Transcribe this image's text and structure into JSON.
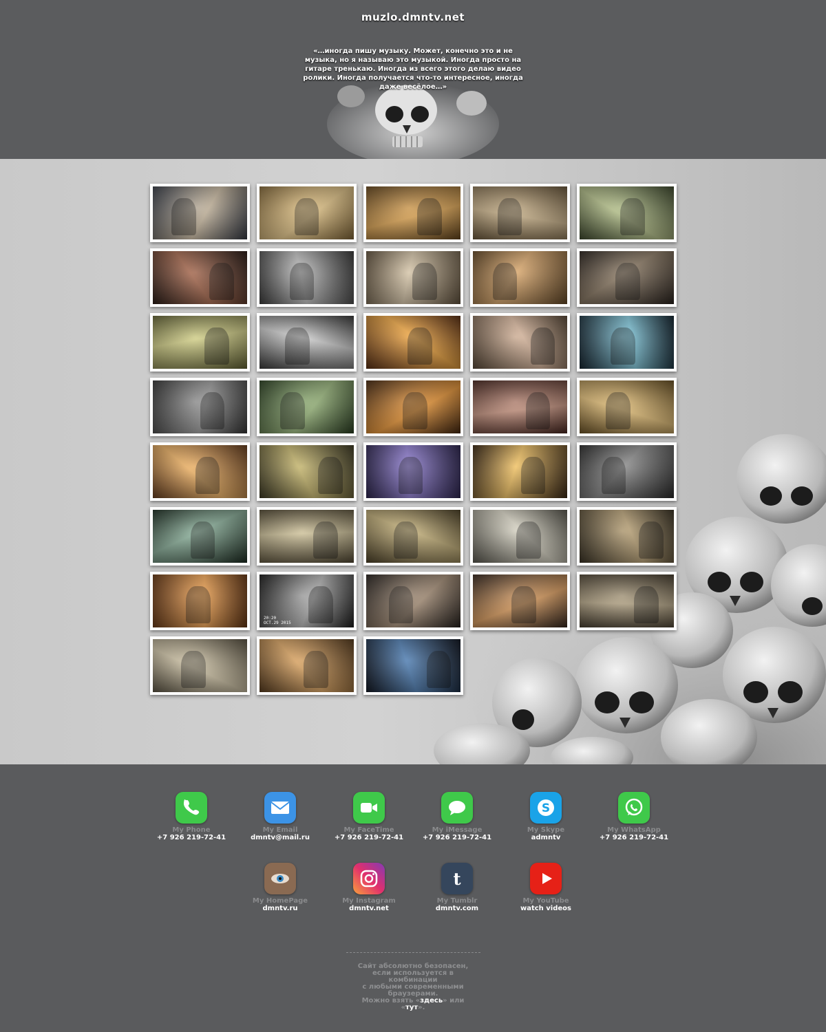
{
  "header": {
    "title": "muzlo.dmntv.net",
    "quote": "«…иногда пишу музыку. Может, конечно это и не музыка, но я называю это музыкой. Иногда просто на гитаре тренькаю. Иногда из всего этого делаю видео ролики. Иногда получается что-то интересное, иногда даже весёлое…»"
  },
  "videos": [
    {
      "tone": "#3a3f4a",
      "accent": "#c9b9a0"
    },
    {
      "tone": "#8c6f3c",
      "accent": "#e8c98a"
    },
    {
      "tone": "#6b4a1e",
      "accent": "#e3a955"
    },
    {
      "tone": "#6e5a3c",
      "accent": "#cdb58c"
    },
    {
      "tone": "#3e4a2c",
      "accent": "#b7c38b"
    },
    {
      "tone": "#2a1a14",
      "accent": "#a4654a"
    },
    {
      "tone": "#3c3c3c",
      "accent": "#bdbdbd"
    },
    {
      "tone": "#6a5a44",
      "accent": "#d4c3a6"
    },
    {
      "tone": "#6c4e2a",
      "accent": "#d9a66a"
    },
    {
      "tone": "#2e2620",
      "accent": "#8c7a64"
    },
    {
      "tone": "#6a6a38",
      "accent": "#d2cf86"
    },
    {
      "tone": "#3a3a3a",
      "accent": "#cfcfcf"
    },
    {
      "tone": "#5c2e10",
      "accent": "#f0a640"
    },
    {
      "tone": "#5c4a38",
      "accent": "#d6b49a"
    },
    {
      "tone": "#122430",
      "accent": "#7cc4d8"
    },
    {
      "tone": "#3a3a3a",
      "accent": "#9a9a9a"
    },
    {
      "tone": "#2e4424",
      "accent": "#98b67a"
    },
    {
      "tone": "#4a2a10",
      "accent": "#f09a38"
    },
    {
      "tone": "#4e2a22",
      "accent": "#c89480"
    },
    {
      "tone": "#6e5424",
      "accent": "#e8c37a"
    },
    {
      "tone": "#6a3e1c",
      "accent": "#f2b464"
    },
    {
      "tone": "#3e3a22",
      "accent": "#c4b46a"
    },
    {
      "tone": "#2c2450",
      "accent": "#8c7ad0"
    },
    {
      "tone": "#3e2a14",
      "accent": "#f0c060"
    },
    {
      "tone": "#2e2e2e",
      "accent": "#8a8a8a"
    },
    {
      "tone": "#1e3024",
      "accent": "#8ab09a"
    },
    {
      "tone": "#5a5038",
      "accent": "#d0c39a"
    },
    {
      "tone": "#4e4226",
      "accent": "#c6b27a"
    },
    {
      "tone": "#5c5a50",
      "accent": "#d8d4c4"
    },
    {
      "tone": "#3a3222",
      "accent": "#b8a074"
    },
    {
      "tone": "#6c3a14",
      "accent": "#f0a250"
    },
    {
      "tone": "#1e1e1e",
      "accent": "#b4b4b4",
      "stamp": "20:20\nOCT.29 2015"
    },
    {
      "tone": "#2a2420",
      "accent": "#a89078"
    },
    {
      "tone": "#3a2a20",
      "accent": "#e0a060"
    },
    {
      "tone": "#4a4030",
      "accent": "#b8a888"
    },
    {
      "tone": "#5e5644",
      "accent": "#d4c8aa"
    },
    {
      "tone": "#5a3c1c",
      "accent": "#dca460"
    },
    {
      "tone": "#0e1420",
      "accent": "#4a7ab0"
    }
  ],
  "contacts": [
    {
      "label": "My Phone",
      "value": "+7 926 219-72-41",
      "icon": "phone-icon",
      "color": "#3fc94a"
    },
    {
      "label": "My Email",
      "value": "dmntv@mail.ru",
      "icon": "mail-icon",
      "color": "#3c93e6"
    },
    {
      "label": "My FaceTime",
      "value": "+7 926 219-72-41",
      "icon": "facetime-icon",
      "color": "#3fc94a"
    },
    {
      "label": "My iMessage",
      "value": "+7 926 219-72-41",
      "icon": "imessage-icon",
      "color": "#3fc94a"
    },
    {
      "label": "My Skype",
      "value": "admntv",
      "icon": "skype-icon",
      "color": "#1aa3e8"
    },
    {
      "label": "My WhatsApp",
      "value": "+7 926 219-72-41",
      "icon": "whatsapp-icon",
      "color": "#3fc94a"
    },
    {
      "label": "My HomePage",
      "value": "dmntv.ru",
      "icon": "eye-icon",
      "color": "#8a6a52"
    },
    {
      "label": "My Instagram",
      "value": "dmntv.net",
      "icon": "instagram-icon",
      "color": "#c13584"
    },
    {
      "label": "My Tumblr",
      "value": "dmntv.com",
      "icon": "tumblr-icon",
      "color": "#35465c"
    },
    {
      "label": "My YouTube",
      "value": "watch videos",
      "icon": "youtube-icon",
      "color": "#e62117"
    }
  ],
  "footer_note": {
    "line1": "Сайт абсолютно безопасен,",
    "line2": "если используется в",
    "line3": "комбинации",
    "line4": "с любыми современными",
    "line5": "браузерами.",
    "line6_pre": "Можно взять «",
    "link1": "здесь",
    "line6_mid": "» или",
    "line7_pre": "«",
    "link2": "тут",
    "line7_post": "»."
  }
}
